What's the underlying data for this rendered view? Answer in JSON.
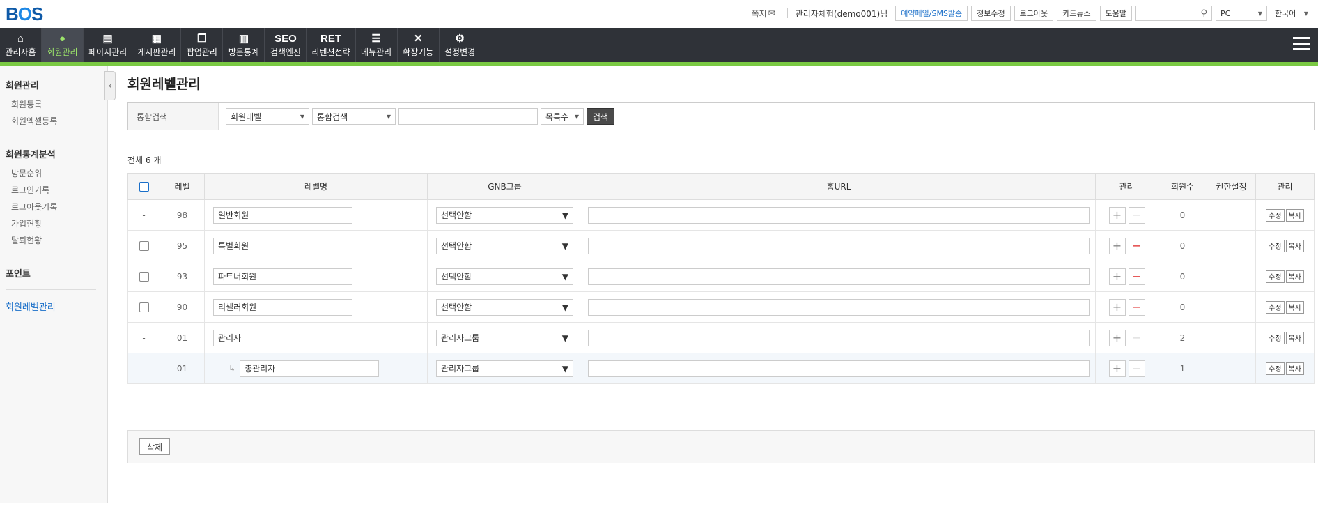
{
  "logo": {
    "b": "B",
    "o": "O",
    "s": "S"
  },
  "top": {
    "message": "쪽지",
    "user": "관리자체험(demo001)님",
    "buttons": [
      "예약메일/SMS발송",
      "정보수정",
      "로그아웃",
      "카드뉴스",
      "도움말"
    ],
    "device": "PC",
    "language": "한국어"
  },
  "gnb": [
    {
      "icon": "⌂",
      "label": "관리자홈"
    },
    {
      "icon": "●",
      "label": "회원관리"
    },
    {
      "icon": "▤",
      "label": "페이지관리"
    },
    {
      "icon": "▦",
      "label": "게시판관리"
    },
    {
      "icon": "❐",
      "label": "팝업관리"
    },
    {
      "icon": "▥",
      "label": "방문통계"
    },
    {
      "icon": "SEO",
      "label": "검색엔진"
    },
    {
      "icon": "RET",
      "label": "리텐션전략"
    },
    {
      "icon": "☰",
      "label": "메뉴관리"
    },
    {
      "icon": "✕",
      "label": "확장기능"
    },
    {
      "icon": "⚙",
      "label": "설정변경"
    }
  ],
  "lnb": {
    "group1": "회원관리",
    "group1_items": [
      "회원등록",
      "회원엑셀등록"
    ],
    "group2": "회원통계분석",
    "group2_items": [
      "방문순위",
      "로그인기록",
      "로그아웃기록",
      "가입현황",
      "탈퇴현황"
    ],
    "group3": "포인트",
    "group4": "회원레벨관리"
  },
  "page_title": "회원레벨관리",
  "search": {
    "label": "통합검색",
    "select1": "회원레벨",
    "select2": "통합검색",
    "keyword": "",
    "list_count": "목록수",
    "button": "검색"
  },
  "total": "전체 6 개",
  "table": {
    "headers": [
      "레벨",
      "레벨명",
      "GNB그룹",
      "홈URL",
      "관리",
      "회원수",
      "권한설정",
      "관리"
    ],
    "rows": [
      {
        "check": "-",
        "level": "98",
        "name": "일반회원",
        "gnb": "선택안함",
        "url": "",
        "count": "0"
      },
      {
        "check": "box",
        "level": "95",
        "name": "특별회원",
        "gnb": "선택안함",
        "url": "",
        "count": "0"
      },
      {
        "check": "box",
        "level": "93",
        "name": "파트너회원",
        "gnb": "선택안함",
        "url": "",
        "count": "0"
      },
      {
        "check": "box",
        "level": "90",
        "name": "리셀러회원",
        "gnb": "선택안함",
        "url": "",
        "count": "0"
      },
      {
        "check": "-",
        "level": "01",
        "name": "관리자",
        "gnb": "관리자그룹",
        "url": "",
        "count": "2"
      },
      {
        "check": "-",
        "level": "01",
        "name": "총관리자",
        "gnb": "관리자그룹",
        "url": "",
        "count": "1"
      }
    ],
    "edit": "수정",
    "copy": "복사"
  },
  "delete_button": "삭제"
}
